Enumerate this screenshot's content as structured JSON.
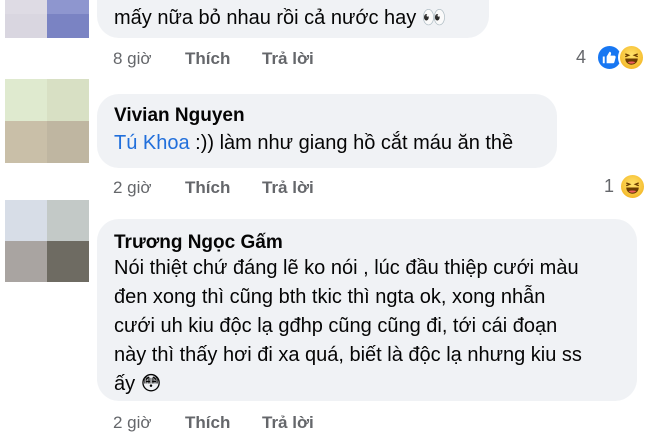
{
  "comments": [
    {
      "author": "",
      "text_lines": [
        "mấy nữa bỏ nhau rồi cả nước hay 👀"
      ],
      "time": "8 giờ",
      "like_label": "Thích",
      "reply_label": "Trả lời",
      "reaction_count": "4",
      "reactions": [
        "like-icon",
        "haha-icon"
      ]
    },
    {
      "author": "Vivian Nguyen",
      "mention": "Tú Khoa",
      "text_after_mention": " :)) làm như giang hồ cắt máu ăn thề",
      "time": "2 giờ",
      "like_label": "Thích",
      "reply_label": "Trả lời",
      "reaction_count": "1",
      "reactions": [
        "haha-icon"
      ]
    },
    {
      "author": "Trương Ngọc Gấm",
      "text_lines": [
        "Nói thiệt chứ đáng lẽ ko nói , lúc đầu thiệp cưới màu",
        "đen xong thì cũng bth tkic thì ngta ok, xong nhẫn",
        "cưới uh kiu độc lạ gđhp cũng cũng đi, tới cái đoạn",
        "này thì thấy hơi đi xa quá, biết là độc lạ nhưng kiu ss",
        "ấy 😳"
      ],
      "time": "2 giờ",
      "like_label": "Thích",
      "reply_label": "Trả lời"
    }
  ],
  "colors": {
    "bubble": "#f0f2f5",
    "meta_text": "#65676b",
    "mention": "#216fdb",
    "like_blue": "#1877f2",
    "haha_yellow": "#f7c339"
  }
}
